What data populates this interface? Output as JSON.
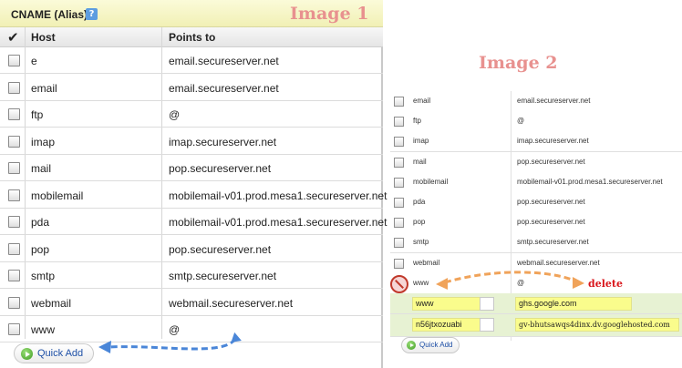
{
  "panel1": {
    "title": "CNAME (Alias)",
    "help_icon_glyph": "?",
    "image_label": "Image 1",
    "columns": {
      "host": "Host",
      "points_to": "Points to"
    },
    "rows": [
      {
        "host": "e",
        "points_to": "email.secureserver.net"
      },
      {
        "host": "email",
        "points_to": "email.secureserver.net"
      },
      {
        "host": "ftp",
        "points_to": "@"
      },
      {
        "host": "imap",
        "points_to": "imap.secureserver.net"
      },
      {
        "host": "mail",
        "points_to": "pop.secureserver.net"
      },
      {
        "host": "mobilemail",
        "points_to": "mobilemail-v01.prod.mesa1.secureserver.net"
      },
      {
        "host": "pda",
        "points_to": "mobilemail-v01.prod.mesa1.secureserver.net"
      },
      {
        "host": "pop",
        "points_to": "pop.secureserver.net"
      },
      {
        "host": "smtp",
        "points_to": "smtp.secureserver.net"
      },
      {
        "host": "webmail",
        "points_to": "webmail.secureserver.net"
      },
      {
        "host": "www",
        "points_to": "@"
      }
    ],
    "quick_add_label": "Quick Add"
  },
  "panel2": {
    "image_label": "Image 2",
    "rows": [
      {
        "host": "email",
        "points_to": "email.secureserver.net"
      },
      {
        "host": "ftp",
        "points_to": "@"
      },
      {
        "host": "imap",
        "points_to": "imap.secureserver.net"
      },
      {
        "host": "mail",
        "points_to": "pop.secureserver.net"
      },
      {
        "host": "mobilemail",
        "points_to": "mobilemail-v01.prod.mesa1.secureserver.net"
      },
      {
        "host": "pda",
        "points_to": "pop.secureserver.net"
      },
      {
        "host": "pop",
        "points_to": "pop.secureserver.net"
      },
      {
        "host": "smtp",
        "points_to": "smtp.secureserver.net"
      },
      {
        "host": "webmail",
        "points_to": "webmail.secureserver.net"
      },
      {
        "host": "www",
        "points_to": "@"
      }
    ],
    "new_rows": [
      {
        "host": "www",
        "points_to": "ghs.google.com"
      },
      {
        "host": "n56jtxozuabi",
        "points_to": "gv-bhutsawqs4dinx.dv.googlehosted.com"
      }
    ],
    "quick_add_label": "Quick Add",
    "delete_label": "delete"
  },
  "colors": {
    "header_yellow": "#f1f0b5",
    "image_label": "#e8918f",
    "input_highlight": "#fafc8c",
    "new_row_green": "#e7f2d3",
    "delete_red": "#d9161b",
    "arrow_orange": "#f0a35a",
    "arrow_blue": "#4a86d8",
    "link_blue": "#1d4fa6"
  }
}
